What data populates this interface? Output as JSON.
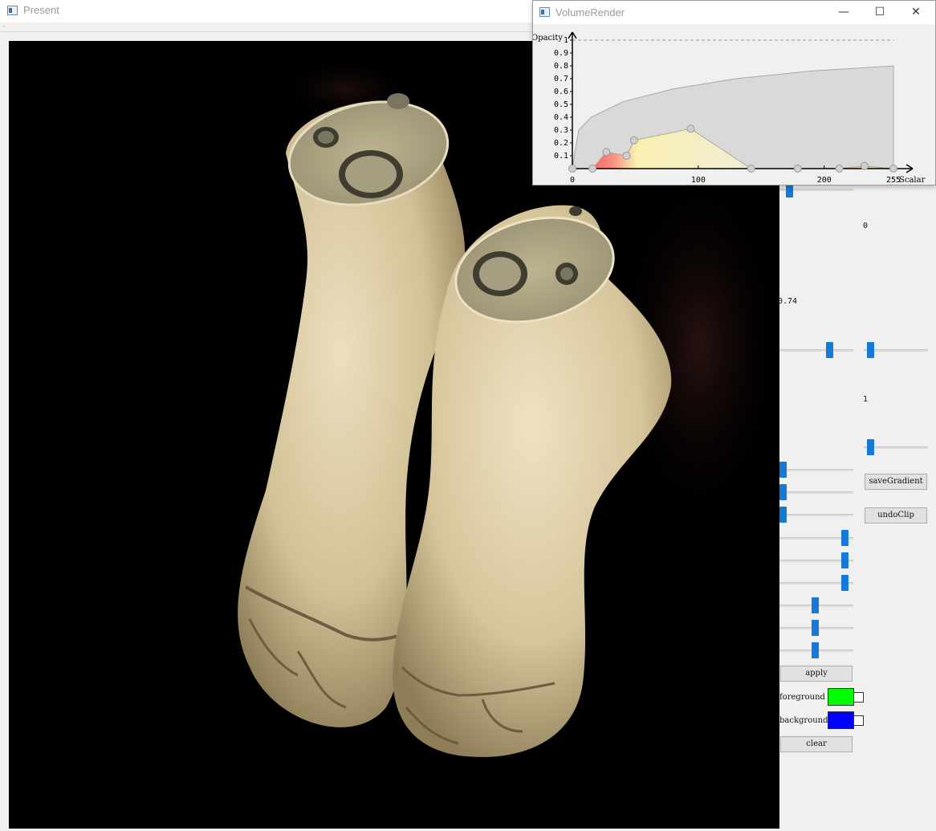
{
  "main_window": {
    "title": "Present",
    "menu_marker": "·"
  },
  "viewport": {
    "background": "#000000",
    "tissue_color": "#d9c9a3"
  },
  "panel": {
    "labels": {
      "value_a": "0",
      "value_b": "0.74",
      "value_c": "1"
    },
    "sliders": {
      "top_partial": 0.1,
      "pair_left": 0.7,
      "pair_right": 0.05,
      "single_right": 0.05,
      "group1": [
        0.0,
        0.0,
        0.0
      ],
      "group2": [
        0.93,
        0.93,
        0.93
      ],
      "group3": [
        0.48,
        0.48,
        0.48
      ]
    },
    "buttons": {
      "save_gradient": "saveGradient",
      "undo_clip": "undoClip",
      "apply": "apply",
      "clear": "clear"
    },
    "foreground": {
      "label": "foreground",
      "color": "#00ff00"
    },
    "background": {
      "label": "background",
      "color": "#0000ff"
    }
  },
  "volume_render": {
    "title": "VolumeRender",
    "controls": {
      "minimize": "—",
      "maximize": "☐",
      "close": "✕"
    }
  },
  "chart_data": {
    "type": "area",
    "ylabel": "Opacity",
    "xlabel": "Scalar",
    "xlim": [
      0,
      255
    ],
    "ylim": [
      0,
      1
    ],
    "x_ticks": [
      "0",
      "100",
      "200",
      "255"
    ],
    "y_ticks": [
      "0.1",
      "0.2",
      "0.3",
      "0.4",
      "0.5",
      "0.6",
      "0.7",
      "0.8",
      "0.9",
      "1"
    ],
    "histogram_curve": [
      [
        0,
        0.0
      ],
      [
        5,
        0.3
      ],
      [
        15,
        0.4
      ],
      [
        40,
        0.52
      ],
      [
        80,
        0.62
      ],
      [
        130,
        0.7
      ],
      [
        190,
        0.76
      ],
      [
        255,
        0.8
      ]
    ],
    "control_points": [
      [
        0,
        0.0
      ],
      [
        16,
        0.0
      ],
      [
        27,
        0.13
      ],
      [
        43,
        0.1
      ],
      [
        49,
        0.22
      ],
      [
        94,
        0.31
      ],
      [
        142,
        0.0
      ],
      [
        179,
        0.0
      ],
      [
        212,
        0.0
      ],
      [
        232,
        0.02
      ],
      [
        255,
        0.0
      ]
    ],
    "reference_line": 1
  }
}
